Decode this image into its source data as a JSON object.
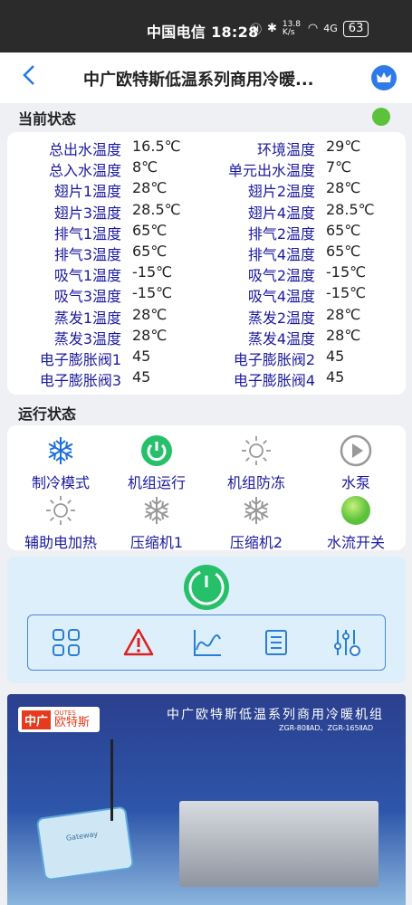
{
  "statusbar": {
    "text": "中国电信 18:28",
    "speed": "13.8 K/s",
    "network": "4G",
    "battery": "63"
  },
  "header": {
    "title": "中广欧特斯低温系列商用冷暖..."
  },
  "sections": {
    "current": "当前状态",
    "running": "运行状态"
  },
  "readings": [
    {
      "l1": "总出水温度",
      "v1": "16.5℃",
      "l2": "环境温度",
      "v2": "29℃"
    },
    {
      "l1": "总入水温度",
      "v1": "8℃",
      "l2": "单元出水温度",
      "v2": "7℃"
    },
    {
      "l1": "翅片1温度",
      "v1": "28℃",
      "l2": "翅片2温度",
      "v2": "28℃"
    },
    {
      "l1": "翅片3温度",
      "v1": "28.5℃",
      "l2": "翅片4温度",
      "v2": "28.5℃"
    },
    {
      "l1": "排气1温度",
      "v1": "65℃",
      "l2": "排气2温度",
      "v2": "65℃"
    },
    {
      "l1": "排气3温度",
      "v1": "65℃",
      "l2": "排气4温度",
      "v2": "65℃"
    },
    {
      "l1": "吸气1温度",
      "v1": "-15℃",
      "l2": "吸气2温度",
      "v2": "-15℃"
    },
    {
      "l1": "吸气3温度",
      "v1": "-15℃",
      "l2": "吸气4温度",
      "v2": "-15℃"
    },
    {
      "l1": "蒸发1温度",
      "v1": "28℃",
      "l2": "蒸发2温度",
      "v2": "28℃"
    },
    {
      "l1": "蒸发3温度",
      "v1": "28℃",
      "l2": "蒸发4温度",
      "v2": "28℃"
    },
    {
      "l1": "电子膨胀阀1",
      "v1": "45",
      "l2": "电子膨胀阀2",
      "v2": "45"
    },
    {
      "l1": "电子膨胀阀3",
      "v1": "45",
      "l2": "电子膨胀阀4",
      "v2": "45"
    }
  ],
  "status_items": [
    {
      "label": "制冷模式",
      "icon": "snowflake-icon",
      "color": "#1e6fe0"
    },
    {
      "label": "机组运行",
      "icon": "power-icon",
      "color": "#26c06a"
    },
    {
      "label": "机组防冻",
      "icon": "sun-icon",
      "color": "#999999"
    },
    {
      "label": "水泵",
      "icon": "play-icon",
      "color": "#999999"
    },
    {
      "label": "辅助电加热",
      "icon": "sun-icon",
      "color": "#999999"
    },
    {
      "label": "压缩机1",
      "icon": "snowflake-icon",
      "color": "#999999"
    },
    {
      "label": "压缩机2",
      "icon": "snowflake-icon",
      "color": "#999999"
    },
    {
      "label": "水流开关",
      "icon": "flow-ball-icon",
      "color": "#5cc23c"
    }
  ],
  "banner": {
    "brand_cn": "中广",
    "brand_en": "OUTES",
    "brand_name": "欧特斯",
    "title": "中广欧特斯低温系列商用冷暖机组",
    "models": "ZGR-80ⅡAD、ZGR-165ⅡAD",
    "device_label": "Gateway"
  }
}
